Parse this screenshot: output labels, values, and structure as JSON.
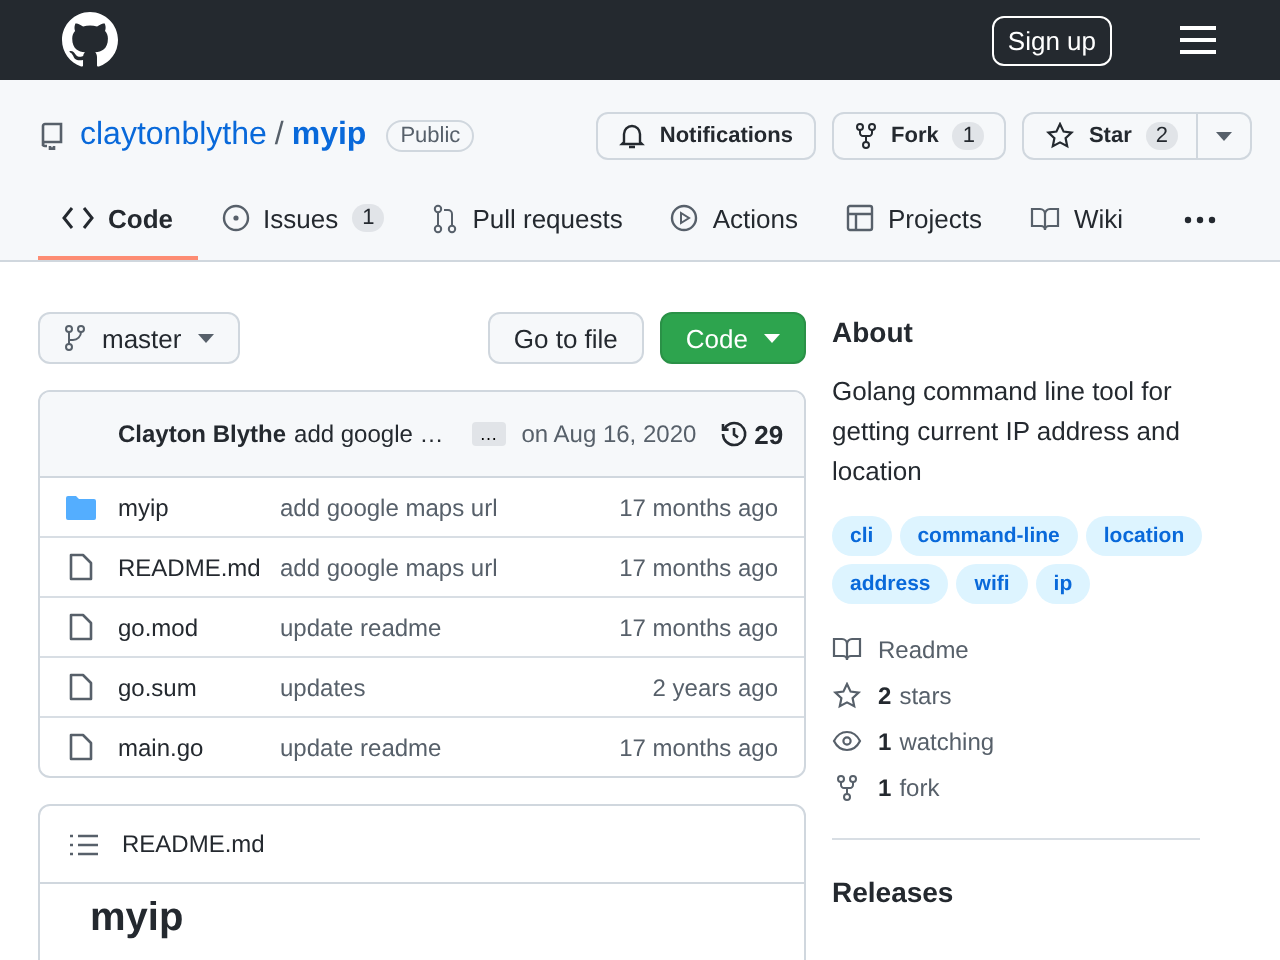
{
  "header": {
    "sign_up": "Sign up"
  },
  "repo": {
    "owner": "claytonblythe",
    "separator": "/",
    "name": "myip",
    "visibility": "Public"
  },
  "repo_actions": [
    {
      "kind": "notifications",
      "label": "Notifications"
    },
    {
      "kind": "fork",
      "label": "Fork",
      "count": "1"
    },
    {
      "kind": "star",
      "label": "Star",
      "count": "2"
    }
  ],
  "tabs": [
    {
      "kind": "code",
      "label": "Code",
      "selected": true
    },
    {
      "kind": "issues",
      "label": "Issues",
      "count": "1",
      "selected": false
    },
    {
      "kind": "pulls",
      "label": "Pull requests",
      "selected": false
    },
    {
      "kind": "actions",
      "label": "Actions",
      "selected": false
    },
    {
      "kind": "projects",
      "label": "Projects",
      "selected": false
    },
    {
      "kind": "wiki",
      "label": "Wiki",
      "selected": false
    }
  ],
  "branch": "master",
  "go_to_file": "Go to file",
  "code_button": "Code",
  "commit": {
    "author": "Clayton Blythe",
    "message": "add google …",
    "ellipsis": "…",
    "date": "on Aug 16, 2020",
    "commits": "29"
  },
  "files": [
    {
      "kind": "folder",
      "name": "myip",
      "message": "add google maps url",
      "age": "17 months ago"
    },
    {
      "kind": "file",
      "name": "README.md",
      "message": "add google maps url",
      "age": "17 months ago"
    },
    {
      "kind": "file",
      "name": "go.mod",
      "message": "update readme",
      "age": "17 months ago"
    },
    {
      "kind": "file",
      "name": "go.sum",
      "message": "updates",
      "age": "2 years ago"
    },
    {
      "kind": "file",
      "name": "main.go",
      "message": "update readme",
      "age": "17 months ago"
    }
  ],
  "readme": {
    "filename": "README.md",
    "heading": "myip"
  },
  "about": {
    "title": "About",
    "description": "Golang command line tool for getting current IP address and location",
    "topics": [
      "cli",
      "command-line",
      "location",
      "address",
      "wifi",
      "ip"
    ],
    "stats": [
      {
        "kind": "readme",
        "label": "Readme"
      },
      {
        "kind": "stars",
        "count": "2",
        "label": "stars"
      },
      {
        "kind": "watching",
        "count": "1",
        "label": "watching"
      },
      {
        "kind": "fork",
        "count": "1",
        "label": "fork"
      }
    ]
  },
  "releases": {
    "title": "Releases"
  }
}
